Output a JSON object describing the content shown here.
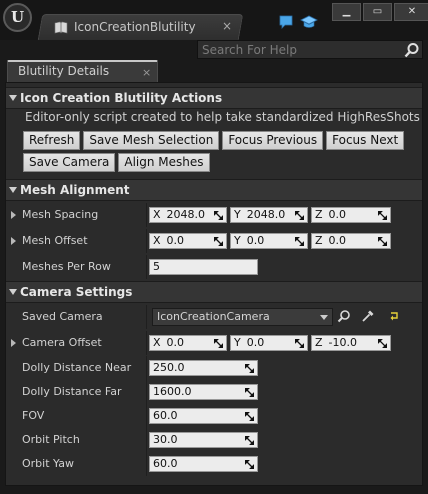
{
  "window": {
    "logo_text": "U",
    "tab_label": "IconCreationBlutility",
    "tab_close": "×",
    "minimize_label": "▁",
    "maximize_label": "▭",
    "close_label": "✕"
  },
  "search": {
    "placeholder": "Search For Help"
  },
  "panel_tab": {
    "label": "Blutility Details",
    "close": "×"
  },
  "sections": {
    "actions": {
      "title": "Icon Creation Blutility Actions",
      "description": "Editor-only script created to help take standardized HighResShots of meshes",
      "buttons_row1": [
        "Refresh",
        "Save Mesh Selection",
        "Focus Previous",
        "Focus Next"
      ],
      "buttons_row2": [
        "Save Camera",
        "Align Meshes"
      ]
    },
    "mesh_alignment": {
      "title": "Mesh Alignment",
      "mesh_spacing": {
        "label": "Mesh Spacing",
        "x": "2048.0",
        "y": "2048.0",
        "z": "0.0"
      },
      "mesh_offset": {
        "label": "Mesh Offset",
        "x": "0.0",
        "y": "0.0",
        "z": "0.0"
      },
      "meshes_per_row": {
        "label": "Meshes Per Row",
        "value": "5"
      }
    },
    "camera_settings": {
      "title": "Camera Settings",
      "saved_camera": {
        "label": "Saved Camera",
        "value": "IconCreationCamera"
      },
      "camera_offset": {
        "label": "Camera Offset",
        "x": "0.0",
        "y": "0.0",
        "z": "-10.0"
      },
      "dolly_near": {
        "label": "Dolly Distance Near",
        "value": "250.0"
      },
      "dolly_far": {
        "label": "Dolly Distance Far",
        "value": "1600.0"
      },
      "fov": {
        "label": "FOV",
        "value": "60.0"
      },
      "orbit_pitch": {
        "label": "Orbit Pitch",
        "value": "30.0"
      },
      "orbit_yaw": {
        "label": "Orbit Yaw",
        "value": "60.0"
      }
    }
  },
  "axis_labels": {
    "x": "X",
    "y": "Y",
    "z": "Z"
  },
  "colors": {
    "button_bg": "#dcdcdc",
    "field_bg": "#ececec",
    "panel_bg": "#2b2b2b",
    "header_bg": "#353535"
  }
}
